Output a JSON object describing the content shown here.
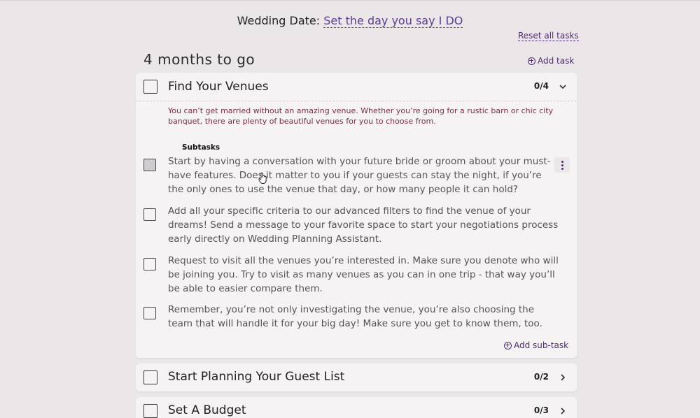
{
  "header": {
    "date_label": "Wedding Date:",
    "date_link": "Set the day you say I DO",
    "reset_label": "Reset all tasks"
  },
  "period": {
    "title": "4 months to go",
    "add_task_label": "Add task"
  },
  "tasks": [
    {
      "title": "Find Your Venues",
      "count": "0/4",
      "expanded": true,
      "description": "You can’t get married without an amazing venue. Whether you’re going for a rustic barn or chic city banquet, there are plenty of beautiful venues for you to choose from.",
      "subtasks_label": "Subtasks",
      "subtasks": [
        {
          "text": "Start by having a conversation with your future bride or groom about your must-have features. Does it matter to you if your guests can stay the night, if you’re the only ones to use the venue that day, or how many people it can hold?"
        },
        {
          "text": "Add all your specific criteria to our advanced filters to find the venue of your dreams! Send a message to your favorite space to start your negotiations process early directly on Wedding Planning Assistant."
        },
        {
          "text": "Request to visit all the venues you’re interested in. Make sure you denote who will be joining you. Try to visit as many venues as you can in one trip - that way you’ll be able to easier compare them."
        },
        {
          "text": "Remember, you’re not only investigating the venue, you’re also choosing the team that will handle it for your big day! Make sure you get to know them, too."
        }
      ],
      "add_subtask_label": "Add sub-task"
    },
    {
      "title": "Start Planning Your Guest List",
      "count": "0/2",
      "expanded": false
    },
    {
      "title": "Set A Budget",
      "count": "0/3",
      "expanded": false
    }
  ],
  "colors": {
    "accent": "#4d2a6e",
    "description": "#7a2d3e",
    "background": "#ebe7e8",
    "card": "#f5f3f4"
  }
}
